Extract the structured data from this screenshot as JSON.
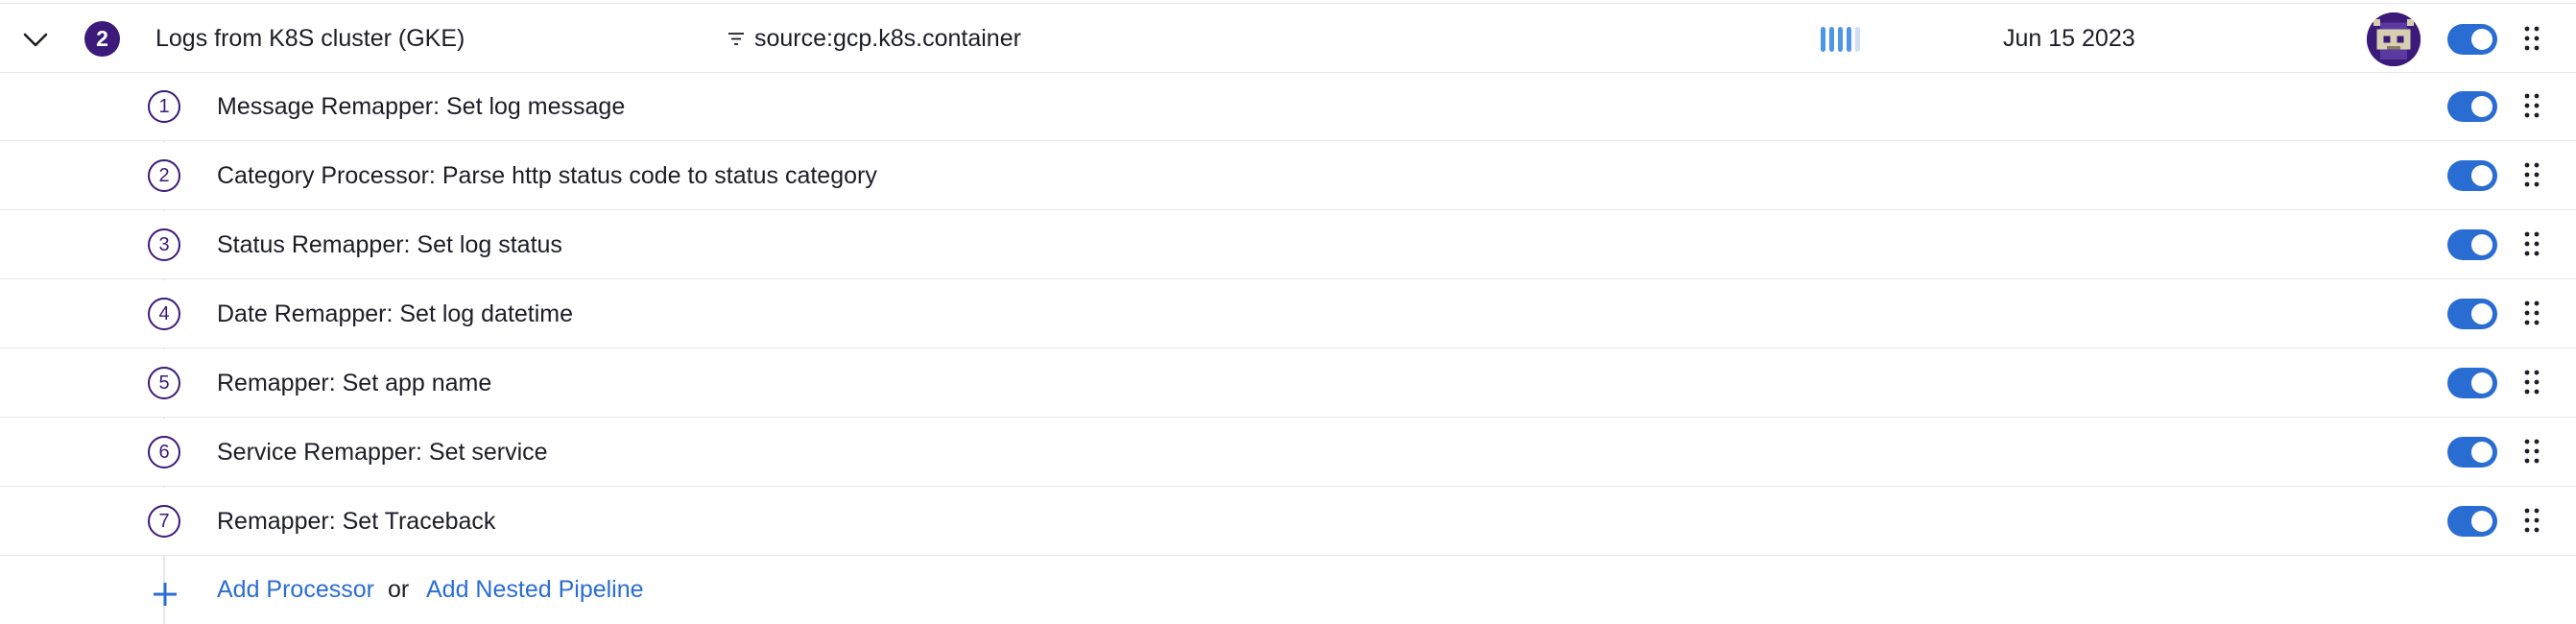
{
  "pipeline": {
    "number": "2",
    "name": "Logs from K8S cluster (GKE)",
    "filter_icon": "filter-icon",
    "filter": "source:gcp.k8s.container",
    "volume_level": 0.8,
    "date": "Jun 15 2023",
    "enabled": true,
    "colors": {
      "accent": "#3b1a7a",
      "toggle": "#2a6dd2",
      "bars": "#4f95e6"
    }
  },
  "processors": [
    {
      "number": "1",
      "name": "Message Remapper: Set log message",
      "enabled": true
    },
    {
      "number": "2",
      "name": "Category Processor: Parse http status code to status category",
      "enabled": true
    },
    {
      "number": "3",
      "name": "Status Remapper: Set log status",
      "enabled": true
    },
    {
      "number": "4",
      "name": "Date Remapper: Set log datetime",
      "enabled": true
    },
    {
      "number": "5",
      "name": "Remapper: Set app name",
      "enabled": true
    },
    {
      "number": "6",
      "name": "Service Remapper: Set service",
      "enabled": true
    },
    {
      "number": "7",
      "name": "Remapper: Set Traceback",
      "enabled": true
    }
  ],
  "footer": {
    "add_processor": "Add Processor",
    "or": "or",
    "add_nested": "Add Nested Pipeline"
  }
}
